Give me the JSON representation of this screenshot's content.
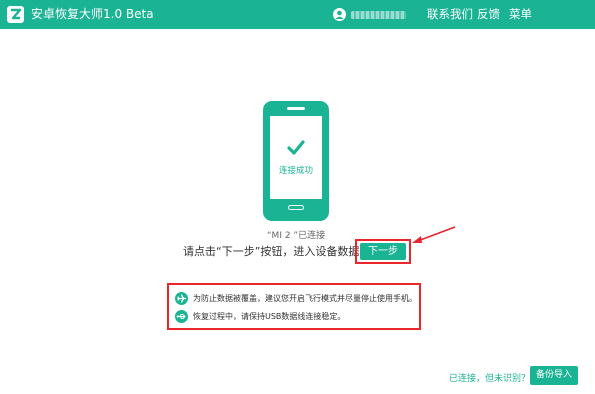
{
  "titlebar": {
    "app_title": "安卓恢复大师1.0 Beta",
    "menu": {
      "contact": "联系我们",
      "feedback": "反馈",
      "menu": "菜单"
    }
  },
  "phone": {
    "status": "连接成功"
  },
  "device_label": "“MI 2 ”已连接",
  "instruction": "请点击“下一步”按钮，进入设备数据扫描",
  "next_button": "下一步",
  "notices": [
    "为防止数据被覆盖，建议您开启飞行模式并尽量停止使用手机。",
    "恢复过程中，请保持USB数据线连接稳定。"
  ],
  "footer": {
    "unrecognized_link": "已连接，但未识别？",
    "backup_button": "备份导入"
  },
  "colors": {
    "accent": "#1ab394",
    "highlight": "#e8262c"
  },
  "icons": {
    "logo": "app-logo-icon",
    "user": "user-icon",
    "check": "check-icon",
    "airplane": "airplane-icon",
    "usb": "usb-icon",
    "arrow": "red-arrow-icon"
  }
}
